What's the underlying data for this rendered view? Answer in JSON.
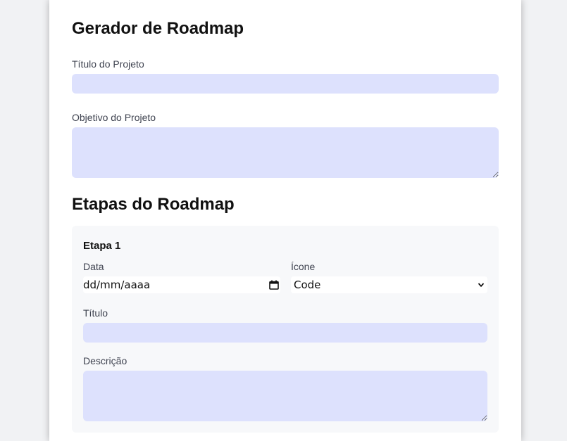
{
  "form": {
    "title": "Gerador de Roadmap",
    "project_title_label": "Título do Projeto",
    "project_title_value": "",
    "project_goal_label": "Objetivo do Projeto",
    "project_goal_value": "",
    "steps_heading": "Etapas do Roadmap"
  },
  "steps": [
    {
      "title": "Etapa 1",
      "date_label": "Data",
      "date_placeholder": "dd/mm/aaaa",
      "icon_label": "Ícone",
      "icon_value": "Code",
      "step_title_label": "Título",
      "step_title_value": "",
      "description_label": "Descrição",
      "description_value": ""
    }
  ],
  "icons": {
    "date_picker": "calendar-icon",
    "select_arrow": "chevron-down-icon"
  },
  "colors": {
    "page_background": "#f1f2f4",
    "card_background": "#ffffff",
    "input_fill": "#dde1fd",
    "step_panel_background": "#f7f8fa",
    "text": "#111111",
    "label_text": "#3f4350"
  }
}
